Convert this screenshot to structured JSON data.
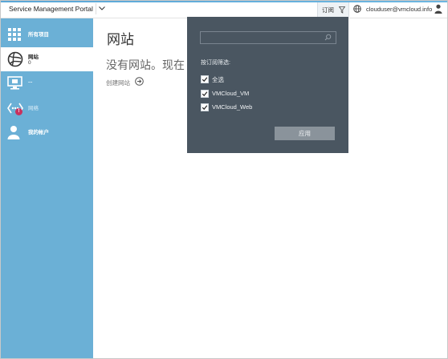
{
  "header": {
    "portal_title": "Service Management Portal",
    "subscription_label": "订阅",
    "user_email": "clouduser@vmcloud.info"
  },
  "sidebar": {
    "items": [
      {
        "label": "所有项目",
        "icon": "grid-icon"
      },
      {
        "label": "网站",
        "count": "0",
        "icon": "websites-icon",
        "active": true
      },
      {
        "label": "...",
        "icon": "monitor-icon"
      },
      {
        "label": "网络",
        "icon": "network-icon",
        "badge": "!"
      },
      {
        "label": "我的帐户",
        "icon": "account-icon"
      }
    ]
  },
  "main": {
    "title": "网站",
    "empty_message": "没有网站。现在",
    "create_link": "创建网站"
  },
  "filter_panel": {
    "search_placeholder": "",
    "heading": "按订阅筛选:",
    "options": [
      {
        "label": "全选",
        "checked": true
      },
      {
        "label": "VMCloud_VM",
        "checked": true
      },
      {
        "label": "VMCloud_Web",
        "checked": true
      }
    ],
    "apply_label": "应用"
  },
  "colors": {
    "sidebar": "#6bb0d6",
    "panel": "#4a5661",
    "apply_button": "#8a939b"
  }
}
